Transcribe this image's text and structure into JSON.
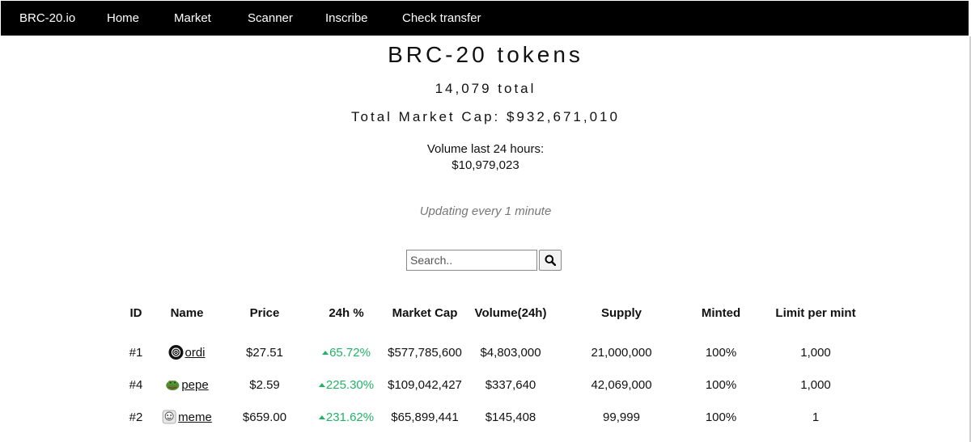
{
  "nav": {
    "brand": "BRC-20.io",
    "items": [
      "Home",
      "Market",
      "Scanner",
      "Inscribe",
      "Check transfer"
    ]
  },
  "header": {
    "title": "BRC-20 tokens",
    "total": "14,079 total",
    "market_cap": "Total Market Cap: $932,671,010",
    "volume_label": "Volume last 24 hours:",
    "volume_value": "$10,979,023",
    "updating": "Updating every 1 minute"
  },
  "search": {
    "placeholder": "Search..",
    "button_icon": "search-icon"
  },
  "table": {
    "columns": [
      "ID",
      "Name",
      "Price",
      "24h %",
      "Market Cap",
      "Volume(24h)",
      "Supply",
      "Minted",
      "Limit per mint"
    ],
    "rows": [
      {
        "id": "#1",
        "name": "ordi",
        "icon": "ordi-icon",
        "price": "$27.51",
        "change": "65.72%",
        "market_cap": "$577,785,600",
        "volume": "$4,803,000",
        "supply": "21,000,000",
        "minted": "100%",
        "limit": "1,000"
      },
      {
        "id": "#4",
        "name": "pepe",
        "icon": "pepe-icon",
        "price": "$2.59",
        "change": "225.30%",
        "market_cap": "$109,042,427",
        "volume": "$337,640",
        "supply": "42,069,000",
        "minted": "100%",
        "limit": "1,000"
      },
      {
        "id": "#2",
        "name": "meme",
        "icon": "meme-icon",
        "price": "$659.00",
        "change": "231.62%",
        "market_cap": "$65,899,441",
        "volume": "$145,408",
        "supply": "99,999",
        "minted": "100%",
        "limit": "1"
      }
    ]
  },
  "colors": {
    "nav_bg": "#000000",
    "positive": "#22b266"
  }
}
